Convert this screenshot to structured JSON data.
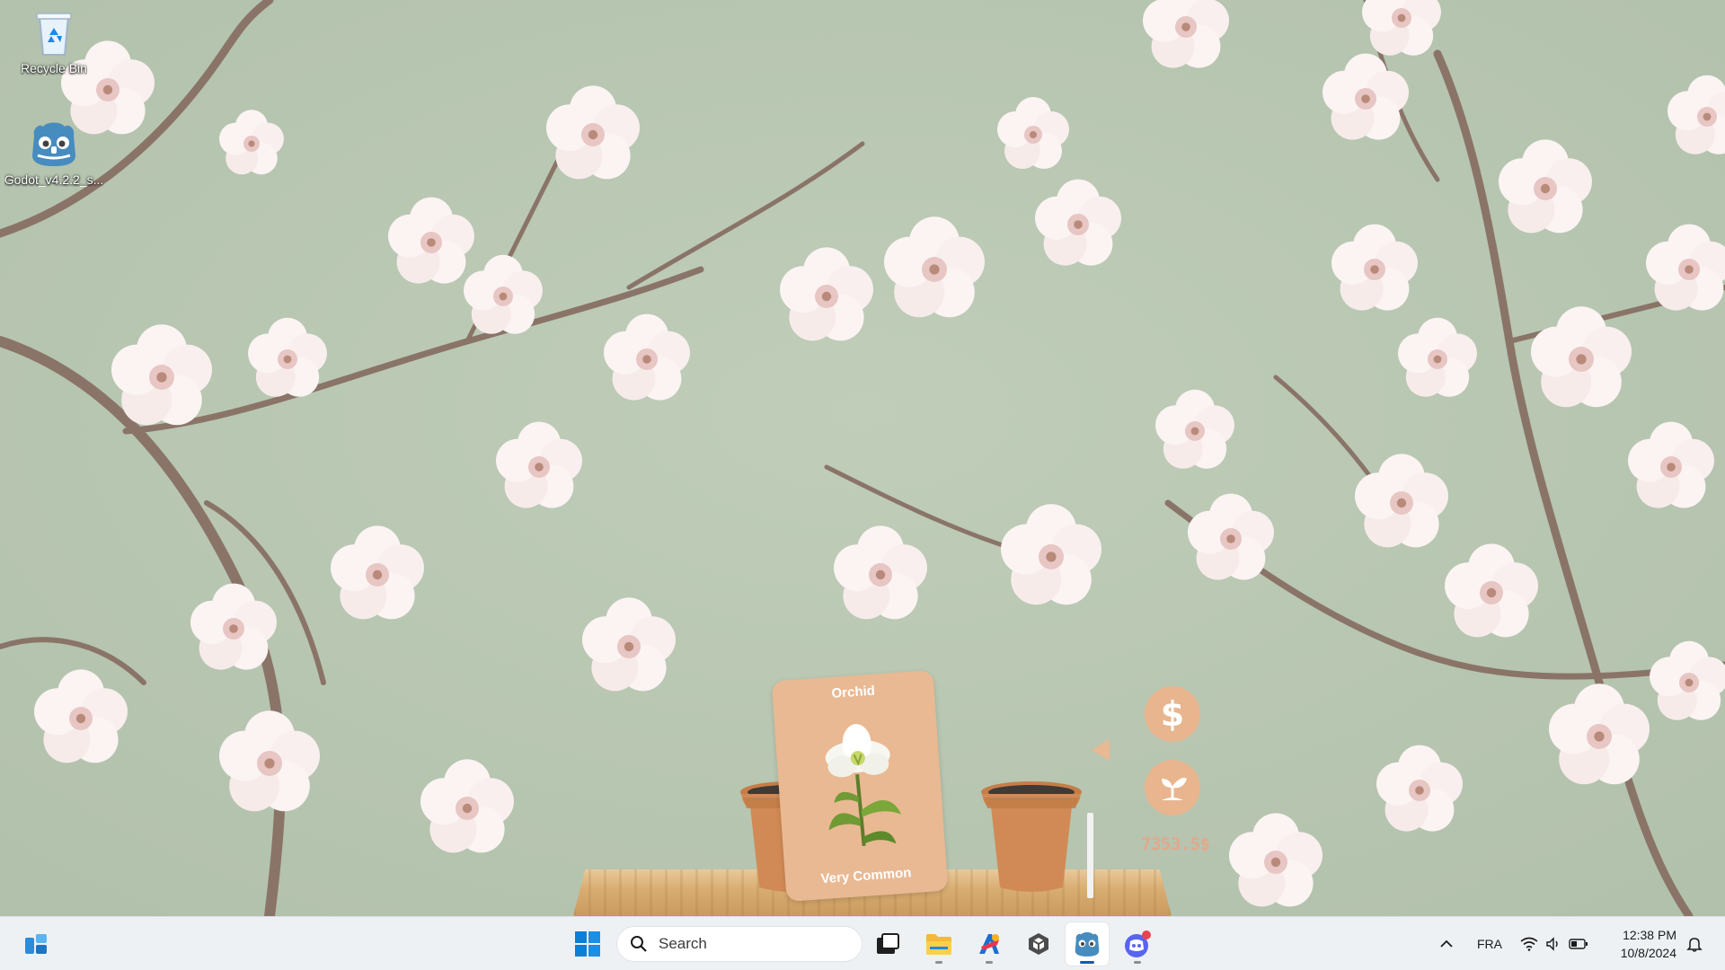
{
  "desktop": {
    "icons": [
      {
        "label": "Recycle Bin",
        "icon": "recycle-bin-icon"
      },
      {
        "label": "Godot_v4.2.2_s...",
        "icon": "godot-icon"
      }
    ]
  },
  "game": {
    "card": {
      "title": "Orchid",
      "rarity": "Very Common",
      "plant_icon": "orchid-flower-icon"
    },
    "buttons": [
      {
        "name": "sell-button",
        "icon": "dollar-icon"
      },
      {
        "name": "plant-button",
        "icon": "sprout-icon"
      }
    ],
    "money": "7353.5$",
    "colors": {
      "card": "#e9b993",
      "button": "#e8b58e",
      "money": "#e3a88a"
    }
  },
  "taskbar": {
    "search_placeholder": "Search",
    "apps": [
      "start-icon",
      "task-view-icon",
      "file-explorer-icon",
      "paint-app-icon",
      "unity-icon",
      "godot-icon",
      "discord-icon"
    ],
    "tray": {
      "language": "FRA",
      "time": "12:38 PM",
      "date": "10/8/2024"
    }
  }
}
